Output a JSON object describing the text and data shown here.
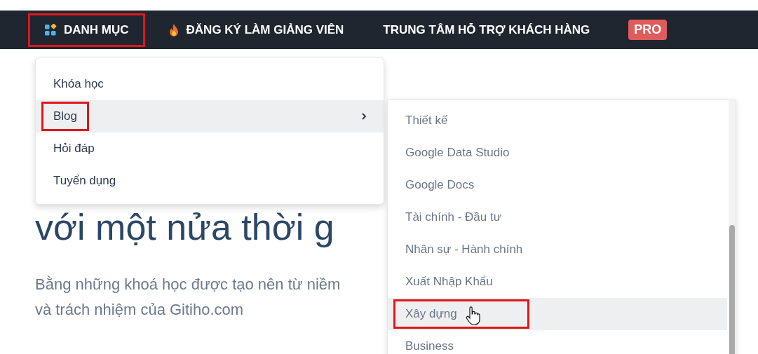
{
  "nav": {
    "items": [
      {
        "kind": "category",
        "label": "DANH MỤC",
        "annotated": true
      },
      {
        "kind": "fire",
        "label": "ĐĂNG KÝ LÀM GIẢNG VIÊN",
        "annotated": false
      },
      {
        "kind": "plain",
        "label": "TRUNG TÂM HỖ TRỢ KHÁCH HÀNG",
        "annotated": false
      },
      {
        "kind": "badge",
        "label": "PRO",
        "annotated": false
      }
    ]
  },
  "hero": {
    "heading": "với một nửa thời g",
    "lines": [
      "Bằng những khoá học được tạo nên từ niềm",
      "và trách nhiệm của Gitiho.com"
    ]
  },
  "menu": {
    "items": [
      {
        "label": "Khóa học",
        "selected": false,
        "has_submenu": false,
        "annotated": false
      },
      {
        "label": "Blog",
        "selected": true,
        "has_submenu": true,
        "annotated": true
      },
      {
        "label": "Hỏi đáp",
        "selected": false,
        "has_submenu": false,
        "annotated": false
      },
      {
        "label": "Tuyển dụng",
        "selected": false,
        "has_submenu": false,
        "annotated": false
      }
    ]
  },
  "submenu": {
    "items": [
      {
        "label": "Thiết kế",
        "selected": false,
        "annotated": false,
        "pointer": false
      },
      {
        "label": "Google Data Studio",
        "selected": false,
        "annotated": false,
        "pointer": false
      },
      {
        "label": "Google Docs",
        "selected": false,
        "annotated": false,
        "pointer": false
      },
      {
        "label": "Tài chính - Đầu tư",
        "selected": false,
        "annotated": false,
        "pointer": false
      },
      {
        "label": "Nhân sự - Hành chính",
        "selected": false,
        "annotated": false,
        "pointer": false
      },
      {
        "label": "Xuất Nhập Khẩu",
        "selected": false,
        "annotated": false,
        "pointer": false
      },
      {
        "label": "Xây dựng",
        "selected": true,
        "annotated": true,
        "pointer": true
      },
      {
        "label": "Business",
        "selected": false,
        "annotated": false,
        "pointer": false
      }
    ]
  }
}
